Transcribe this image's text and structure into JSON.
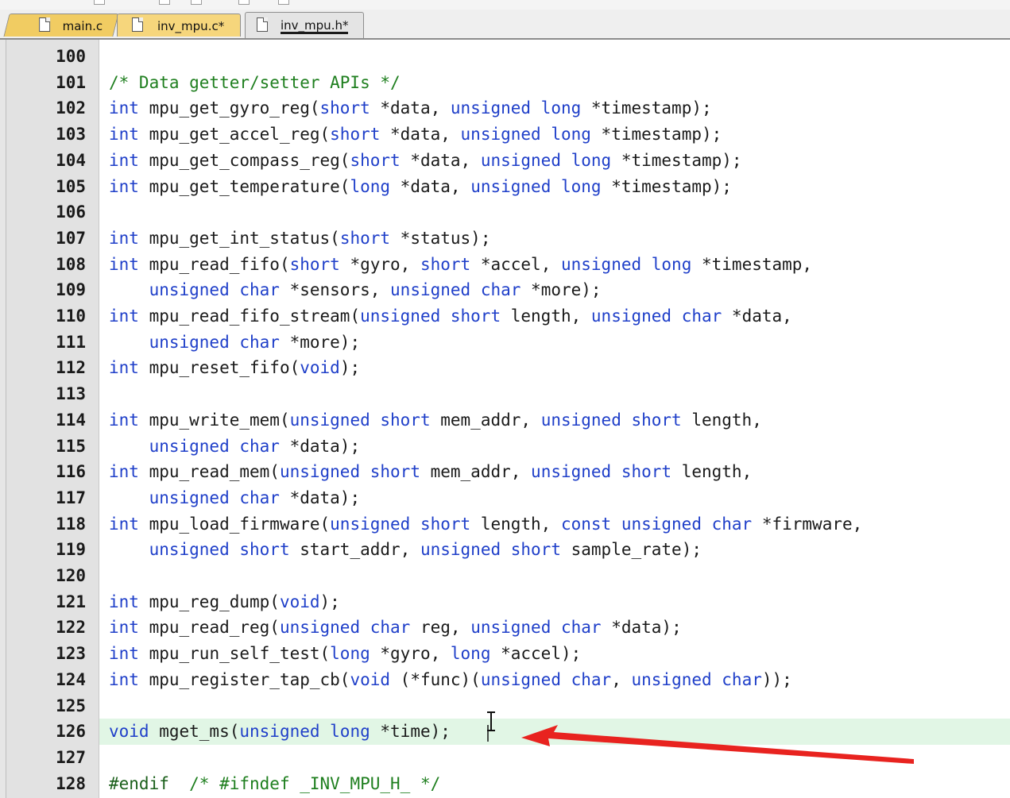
{
  "tabs": [
    {
      "label": "main.c"
    },
    {
      "label": "inv_mpu.c*"
    },
    {
      "label": "inv_mpu.h*",
      "active": true
    }
  ],
  "lines": [
    {
      "n": "100",
      "parts": []
    },
    {
      "n": "101",
      "parts": [
        {
          "t": "/* Data getter/setter APIs */",
          "c": "cm"
        }
      ]
    },
    {
      "n": "102",
      "parts": [
        {
          "t": "int",
          "c": "kw"
        },
        {
          "t": " mpu_get_gyro_reg("
        },
        {
          "t": "short",
          "c": "kw"
        },
        {
          "t": " *data, "
        },
        {
          "t": "unsigned long",
          "c": "kw"
        },
        {
          "t": " *timestamp);"
        }
      ]
    },
    {
      "n": "103",
      "parts": [
        {
          "t": "int",
          "c": "kw"
        },
        {
          "t": " mpu_get_accel_reg("
        },
        {
          "t": "short",
          "c": "kw"
        },
        {
          "t": " *data, "
        },
        {
          "t": "unsigned long",
          "c": "kw"
        },
        {
          "t": " *timestamp);"
        }
      ]
    },
    {
      "n": "104",
      "parts": [
        {
          "t": "int",
          "c": "kw"
        },
        {
          "t": " mpu_get_compass_reg("
        },
        {
          "t": "short",
          "c": "kw"
        },
        {
          "t": " *data, "
        },
        {
          "t": "unsigned long",
          "c": "kw"
        },
        {
          "t": " *timestamp);"
        }
      ]
    },
    {
      "n": "105",
      "parts": [
        {
          "t": "int",
          "c": "kw"
        },
        {
          "t": " mpu_get_temperature("
        },
        {
          "t": "long",
          "c": "kw"
        },
        {
          "t": " *data, "
        },
        {
          "t": "unsigned long",
          "c": "kw"
        },
        {
          "t": " *timestamp);"
        }
      ]
    },
    {
      "n": "106",
      "parts": []
    },
    {
      "n": "107",
      "parts": [
        {
          "t": "int",
          "c": "kw"
        },
        {
          "t": " mpu_get_int_status("
        },
        {
          "t": "short",
          "c": "kw"
        },
        {
          "t": " *status);"
        }
      ]
    },
    {
      "n": "108",
      "parts": [
        {
          "t": "int",
          "c": "kw"
        },
        {
          "t": " mpu_read_fifo("
        },
        {
          "t": "short",
          "c": "kw"
        },
        {
          "t": " *gyro, "
        },
        {
          "t": "short",
          "c": "kw"
        },
        {
          "t": " *accel, "
        },
        {
          "t": "unsigned long",
          "c": "kw"
        },
        {
          "t": " *timestamp,"
        }
      ]
    },
    {
      "n": "109",
      "parts": [
        {
          "t": "    "
        },
        {
          "t": "unsigned char",
          "c": "kw"
        },
        {
          "t": " *sensors, "
        },
        {
          "t": "unsigned char",
          "c": "kw"
        },
        {
          "t": " *more);"
        }
      ]
    },
    {
      "n": "110",
      "parts": [
        {
          "t": "int",
          "c": "kw"
        },
        {
          "t": " mpu_read_fifo_stream("
        },
        {
          "t": "unsigned short",
          "c": "kw"
        },
        {
          "t": " length, "
        },
        {
          "t": "unsigned char",
          "c": "kw"
        },
        {
          "t": " *data,"
        }
      ]
    },
    {
      "n": "111",
      "parts": [
        {
          "t": "    "
        },
        {
          "t": "unsigned char",
          "c": "kw"
        },
        {
          "t": " *more);"
        }
      ]
    },
    {
      "n": "112",
      "parts": [
        {
          "t": "int",
          "c": "kw"
        },
        {
          "t": " mpu_reset_fifo("
        },
        {
          "t": "void",
          "c": "kw"
        },
        {
          "t": ");"
        }
      ]
    },
    {
      "n": "113",
      "parts": []
    },
    {
      "n": "114",
      "parts": [
        {
          "t": "int",
          "c": "kw"
        },
        {
          "t": " mpu_write_mem("
        },
        {
          "t": "unsigned short",
          "c": "kw"
        },
        {
          "t": " mem_addr, "
        },
        {
          "t": "unsigned short",
          "c": "kw"
        },
        {
          "t": " length,"
        }
      ]
    },
    {
      "n": "115",
      "parts": [
        {
          "t": "    "
        },
        {
          "t": "unsigned char",
          "c": "kw"
        },
        {
          "t": " *data);"
        }
      ]
    },
    {
      "n": "116",
      "parts": [
        {
          "t": "int",
          "c": "kw"
        },
        {
          "t": " mpu_read_mem("
        },
        {
          "t": "unsigned short",
          "c": "kw"
        },
        {
          "t": " mem_addr, "
        },
        {
          "t": "unsigned short",
          "c": "kw"
        },
        {
          "t": " length,"
        }
      ]
    },
    {
      "n": "117",
      "parts": [
        {
          "t": "    "
        },
        {
          "t": "unsigned char",
          "c": "kw"
        },
        {
          "t": " *data);"
        }
      ]
    },
    {
      "n": "118",
      "parts": [
        {
          "t": "int",
          "c": "kw"
        },
        {
          "t": " mpu_load_firmware("
        },
        {
          "t": "unsigned short",
          "c": "kw"
        },
        {
          "t": " length, "
        },
        {
          "t": "const unsigned char",
          "c": "kw"
        },
        {
          "t": " *firmware,"
        }
      ]
    },
    {
      "n": "119",
      "parts": [
        {
          "t": "    "
        },
        {
          "t": "unsigned short",
          "c": "kw"
        },
        {
          "t": " start_addr, "
        },
        {
          "t": "unsigned short",
          "c": "kw"
        },
        {
          "t": " sample_rate);"
        }
      ]
    },
    {
      "n": "120",
      "parts": []
    },
    {
      "n": "121",
      "parts": [
        {
          "t": "int",
          "c": "kw"
        },
        {
          "t": " mpu_reg_dump("
        },
        {
          "t": "void",
          "c": "kw"
        },
        {
          "t": ");"
        }
      ]
    },
    {
      "n": "122",
      "parts": [
        {
          "t": "int",
          "c": "kw"
        },
        {
          "t": " mpu_read_reg("
        },
        {
          "t": "unsigned char",
          "c": "kw"
        },
        {
          "t": " reg, "
        },
        {
          "t": "unsigned char",
          "c": "kw"
        },
        {
          "t": " *data);"
        }
      ]
    },
    {
      "n": "123",
      "parts": [
        {
          "t": "int",
          "c": "kw"
        },
        {
          "t": " mpu_run_self_test("
        },
        {
          "t": "long",
          "c": "kw"
        },
        {
          "t": " *gyro, "
        },
        {
          "t": "long",
          "c": "kw"
        },
        {
          "t": " *accel);"
        }
      ]
    },
    {
      "n": "124",
      "parts": [
        {
          "t": "int",
          "c": "kw"
        },
        {
          "t": " mpu_register_tap_cb("
        },
        {
          "t": "void",
          "c": "kw"
        },
        {
          "t": " (*func)("
        },
        {
          "t": "unsigned char",
          "c": "kw"
        },
        {
          "t": ", "
        },
        {
          "t": "unsigned char",
          "c": "kw"
        },
        {
          "t": "));"
        }
      ]
    },
    {
      "n": "125",
      "parts": []
    },
    {
      "n": "126",
      "parts": [
        {
          "t": "void",
          "c": "kw"
        },
        {
          "t": " mget_ms("
        },
        {
          "t": "unsigned long",
          "c": "kw"
        },
        {
          "t": " *time);"
        }
      ],
      "highlight": true
    },
    {
      "n": "127",
      "parts": []
    },
    {
      "n": "128",
      "parts": [
        {
          "t": "#endif",
          "c": "pp"
        },
        {
          "t": "  "
        },
        {
          "t": "/* #ifndef _INV_MPU_H_ */",
          "c": "cm"
        }
      ]
    }
  ],
  "colors": {
    "keyword": "#1f3fc9",
    "comment": "#1f7f1f",
    "highlight_line": "#e1f6e5",
    "arrow": "#e8231f"
  }
}
